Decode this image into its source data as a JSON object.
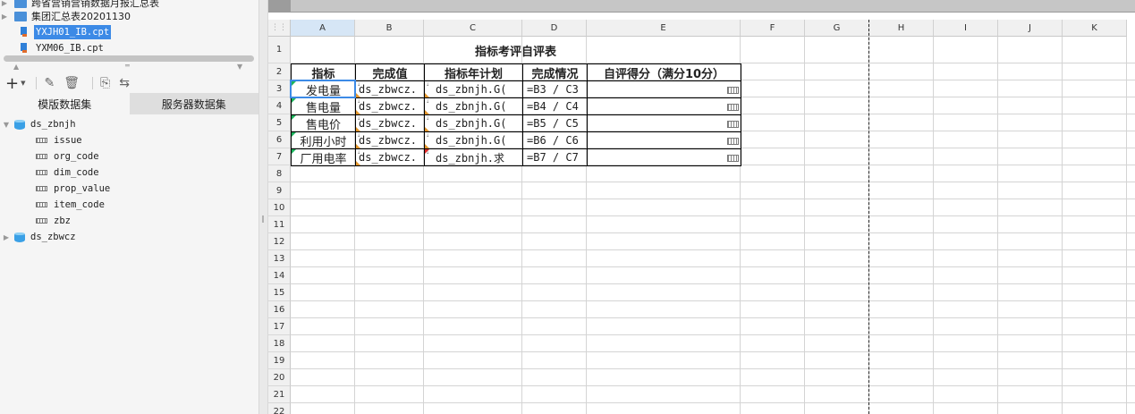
{
  "file_tree": {
    "folders": [
      {
        "label": "跨省营销营销数据月报汇总表"
      },
      {
        "label": "集团汇总表20201130"
      }
    ],
    "files": [
      {
        "label": "YXJH01_IB.cpt",
        "selected": true
      },
      {
        "label": "YXM06_IB.cpt",
        "selected": false
      }
    ]
  },
  "dataset_toolbar": {
    "icons": [
      "add-icon",
      "edit-icon",
      "delete-icon",
      "preview-icon",
      "replace-icon"
    ]
  },
  "dataset_tabs": [
    {
      "label": "模版数据集",
      "active": true
    },
    {
      "label": "服务器数据集",
      "active": false
    }
  ],
  "datasets": [
    {
      "name": "ds_zbnjh",
      "expanded": true,
      "fields": [
        "issue",
        "org_code",
        "dim_code",
        "prop_value",
        "item_code",
        "zbz"
      ]
    },
    {
      "name": "ds_zbwcz",
      "expanded": false,
      "fields": []
    }
  ],
  "sheet": {
    "columns": [
      "A",
      "B",
      "C",
      "D",
      "E",
      "F",
      "G",
      "H",
      "I",
      "J",
      "K"
    ],
    "selected_column": "A",
    "rows": [
      "1",
      "2",
      "3",
      "4",
      "5",
      "6",
      "7",
      "8",
      "9",
      "10",
      "11",
      "12",
      "13",
      "14",
      "15",
      "16",
      "17",
      "18",
      "19",
      "20",
      "21",
      "22"
    ],
    "title": "指标考评自评表",
    "headers": [
      "指标",
      "完成值",
      "指标年计划",
      "完成情况",
      "自评得分（满分10分）"
    ],
    "data_rows": [
      {
        "indicator": "发电量",
        "actual": "ds_zbwcz.",
        "plan": "ds_zbnjh.G(",
        "status": "=B3 / C3"
      },
      {
        "indicator": "售电量",
        "actual": "ds_zbwcz.",
        "plan": "ds_zbnjh.G(",
        "status": "=B4 / C4"
      },
      {
        "indicator": "售电价",
        "actual": "ds_zbwcz.",
        "plan": "ds_zbnjh.G(",
        "status": "=B5 / C5"
      },
      {
        "indicator": "利用小时",
        "actual": "ds_zbwcz.",
        "plan": "ds_zbnjh.G(",
        "status": "=B6 / C6"
      },
      {
        "indicator": "厂用电率",
        "actual": "ds_zbwcz.",
        "plan": "ds_zbnjh.求",
        "status": "=B7 / C7"
      }
    ],
    "selected_cell": "A3"
  },
  "colors": {
    "selection": "#3c8ae6",
    "marker_green": "#1bb35c",
    "marker_orange": "#e3962b",
    "marker_red": "#e02828",
    "folder": "#4a90d9"
  }
}
